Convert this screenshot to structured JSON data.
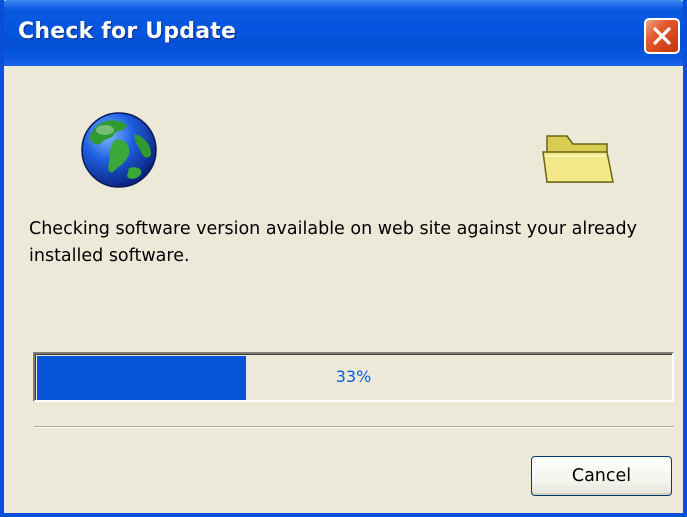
{
  "window": {
    "title": "Check for Update",
    "close_icon": "close-icon"
  },
  "icons": {
    "left": "globe-icon",
    "right": "folder-icon"
  },
  "message": "Checking software version available on web site against your already installed software.",
  "progress": {
    "percent": 33,
    "label": "33%"
  },
  "buttons": {
    "cancel_label": "Cancel"
  },
  "colors": {
    "titlebar": "#0655e0",
    "progress_fill": "#0654d8",
    "progress_text": "#0b5ae0",
    "close_button": "#d4421c",
    "dialog_background": "#ece9d8"
  }
}
